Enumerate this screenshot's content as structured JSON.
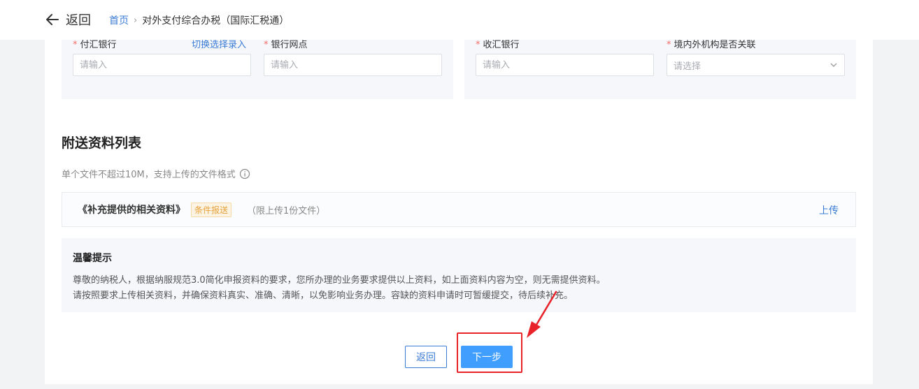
{
  "header": {
    "back_label": "返回",
    "breadcrumb_home": "首页",
    "breadcrumb_sep": "›",
    "breadcrumb_current": "对外支付综合办税（国际汇税通）"
  },
  "form": {
    "remit_bank_label": "付汇银行",
    "switch_link": "切换选择录入",
    "bank_branch_label": "银行网点",
    "receive_bank_label": "收汇银行",
    "related_label": "境内外机构是否关联",
    "input_placeholder": "请输入",
    "select_placeholder": "请选择"
  },
  "attachments": {
    "title": "附送资料列表",
    "hint": "单个文件不超过10M，支持上传的文件格式",
    "file_name": "《补充提供的相关资料》",
    "badge": "条件报送",
    "limit": "（限上传1份文件）",
    "upload": "上传"
  },
  "tips": {
    "title": "温馨提示",
    "line1": "尊敬的纳税人，根据纳服规范3.0简化申报资料的要求，您所办理的业务要求提供以上资料，如上面资料内容为空，则无需提供资料。",
    "line2": "请按照要求上传相关资料，并确保资料真实、准确、清晰，以免影响业务办理。容缺的资料申请时可暂缓提交，待后续补充。"
  },
  "footer": {
    "back_button": "返回",
    "next_button": "下一步"
  },
  "colors": {
    "accent": "#3a7bd5",
    "primary_button": "#409eff",
    "highlight": "#e8242a",
    "required": "#f56c6c"
  }
}
